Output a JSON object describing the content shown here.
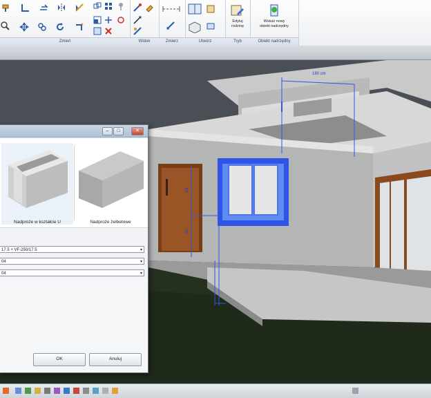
{
  "ribbon": {
    "panels": [
      {
        "id": "zmien",
        "title": "Zmień"
      },
      {
        "id": "widok",
        "title": "Widok"
      },
      {
        "id": "zmierz",
        "title": "Zmierz"
      },
      {
        "id": "utworz",
        "title": "Utwórz"
      },
      {
        "id": "tryb",
        "title": "Tryb"
      },
      {
        "id": "obiekt",
        "title": "Obiekt nadrzędny"
      }
    ],
    "edit_family_label_1": "Edytuj",
    "edit_family_label_2": "rodzinę",
    "new_host_label_1": "Wskaż nowy",
    "new_host_label_2": "obiekt nadrzędny"
  },
  "viewport": {
    "dim_top": "180 cm",
    "dim_side_1": "64",
    "dim_side_2": "60"
  },
  "dialog": {
    "tiles": [
      {
        "label": "Nadproże w kształcie U"
      },
      {
        "label": "Nadproże żelbetowe"
      }
    ],
    "combo_1": "17.5 + VF-250/17.5",
    "combo_2": "04",
    "combo_3": "04",
    "ok_label": "OK",
    "cancel_label": "Anuluj"
  },
  "colors": {
    "selection_blue": "#2f55e6",
    "window_frame": "#3a6fe8",
    "door_brown": "#8a4a1e",
    "wall_grey": "#b5b6b6",
    "grass": "#27301f"
  }
}
